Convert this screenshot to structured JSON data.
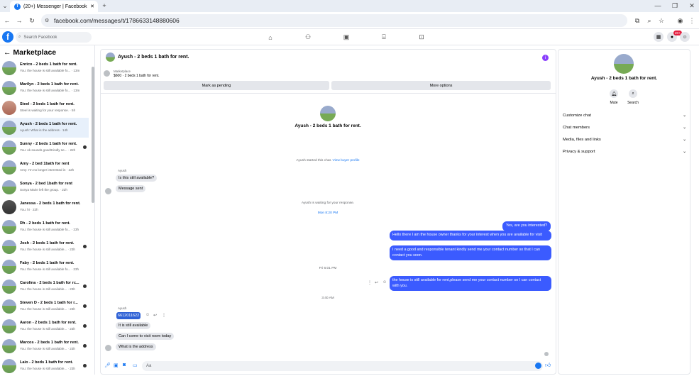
{
  "browser": {
    "tab_title": "(20+) Messenger | Facebook",
    "url": "facebook.com/messages/t/1786633148880606",
    "new_tab": "+"
  },
  "fb": {
    "search_placeholder": "Search Facebook",
    "notif_badge": "20+"
  },
  "sidebar": {
    "title": "Marketplace",
    "chats": [
      {
        "title": "Enrico - 2 beds 1 bath for rent.",
        "snippet": "You: the house is still available fo... · 13m",
        "icon": ""
      },
      {
        "title": "Marilyn - 2 beds 1 bath for rent.",
        "snippet": "You: the house is still available fo... · 13m",
        "icon": ""
      },
      {
        "title": "Steel - 2 beds 1 bath for rent.",
        "snippet": "Steel is waiting for your response. · 5h",
        "icon": ""
      },
      {
        "title": "Ayush - 2 beds 1 bath for rent.",
        "snippet": "Ayush: What is the address · 14h",
        "icon": ""
      },
      {
        "title": "Sunny - 2 beds 1 bath for rent.",
        "snippet": "You: ok sounds good!Kindly se... · 22h",
        "icon": "dot"
      },
      {
        "title": "Amy - 2 bed 1bath for rent",
        "snippet": "Amy: I'm no longer interested in · 22h",
        "icon": ""
      },
      {
        "title": "Sonya - 2 bed 1bath for rent",
        "snippet": "Sonya Marie left the group. · 22h",
        "icon": ""
      },
      {
        "title": "Janessa - 2 beds 1 bath for rent.",
        "snippet": "You: hi · 22h",
        "icon": ""
      },
      {
        "title": "Rh - 2 beds 1 bath for rent.",
        "snippet": "You: the house is still available fo... · 23h",
        "icon": ""
      },
      {
        "title": "Josh - 2 beds 1 bath for rent.",
        "snippet": "You: the house is still available... · 23h",
        "icon": "dot"
      },
      {
        "title": "Faby - 2 beds 1 bath for rent.",
        "snippet": "You: the house is still available fo... · 23h",
        "icon": ""
      },
      {
        "title": "Carolina - 2 beds 1 bath for rc...",
        "snippet": "You: the house is still available... · 23h",
        "icon": "dot"
      },
      {
        "title": "Steven D - 2 beds 1 bath for r...",
        "snippet": "You: the house is still available... · 23h",
        "icon": "dot"
      },
      {
        "title": "Aaron - 2 beds 1 bath for rent.",
        "snippet": "You: the house is still available... · 23h",
        "icon": "dot"
      },
      {
        "title": "Marcos - 2 beds 1 bath for rent.",
        "snippet": "You: the house is still available... · 23h",
        "icon": "dot"
      },
      {
        "title": "Laio - 2 beds 1 bath for rent.",
        "snippet": "You: the house is still available... · 23h",
        "icon": "dot"
      }
    ]
  },
  "conversation": {
    "title": "Ayush - 2 beds 1 bath for rent.",
    "marketplace_label": "Marketplace",
    "listing": "$600 · 2 beds 1 bath for rent.",
    "mark_pending": "Mark as pending",
    "more_options": "More options",
    "center_title": "Ayush - 2 beds 1 bath for rent.",
    "started_text": "Ayush started this chat.",
    "view_profile": "View buyer profile",
    "sender1": "Ayush",
    "in1": "Is this still available?",
    "in2": "Message sent",
    "waiting": "Ayush is waiting for your response.",
    "ts1": "Mon 8:20 PM",
    "out1": "Yes, are you interested?",
    "out2": "Hello there I am the house owner thanks for your interest when you are available for visit",
    "out3": "I need a good and responsible tenant kindly send me your contact number so that I can contact you soon.",
    "ts2": "Fri 6:01 PM",
    "out4": "the house is still available for rent,please send me your contact number so I can contact with you.",
    "ts3": "3:40 AM",
    "sender2": "Ayush",
    "in3": "6612011622",
    "in4": "It is still available",
    "in5": "Can I come to visit room today",
    "in6": "What is the address",
    "composer": "Aa"
  },
  "details": {
    "title": "Ayush - 2 beds 1 bath for rent.",
    "mute": "Mute",
    "search": "Search",
    "options": [
      "Customize chat",
      "Chat members",
      "Media, files and links",
      "Privacy & support"
    ]
  }
}
